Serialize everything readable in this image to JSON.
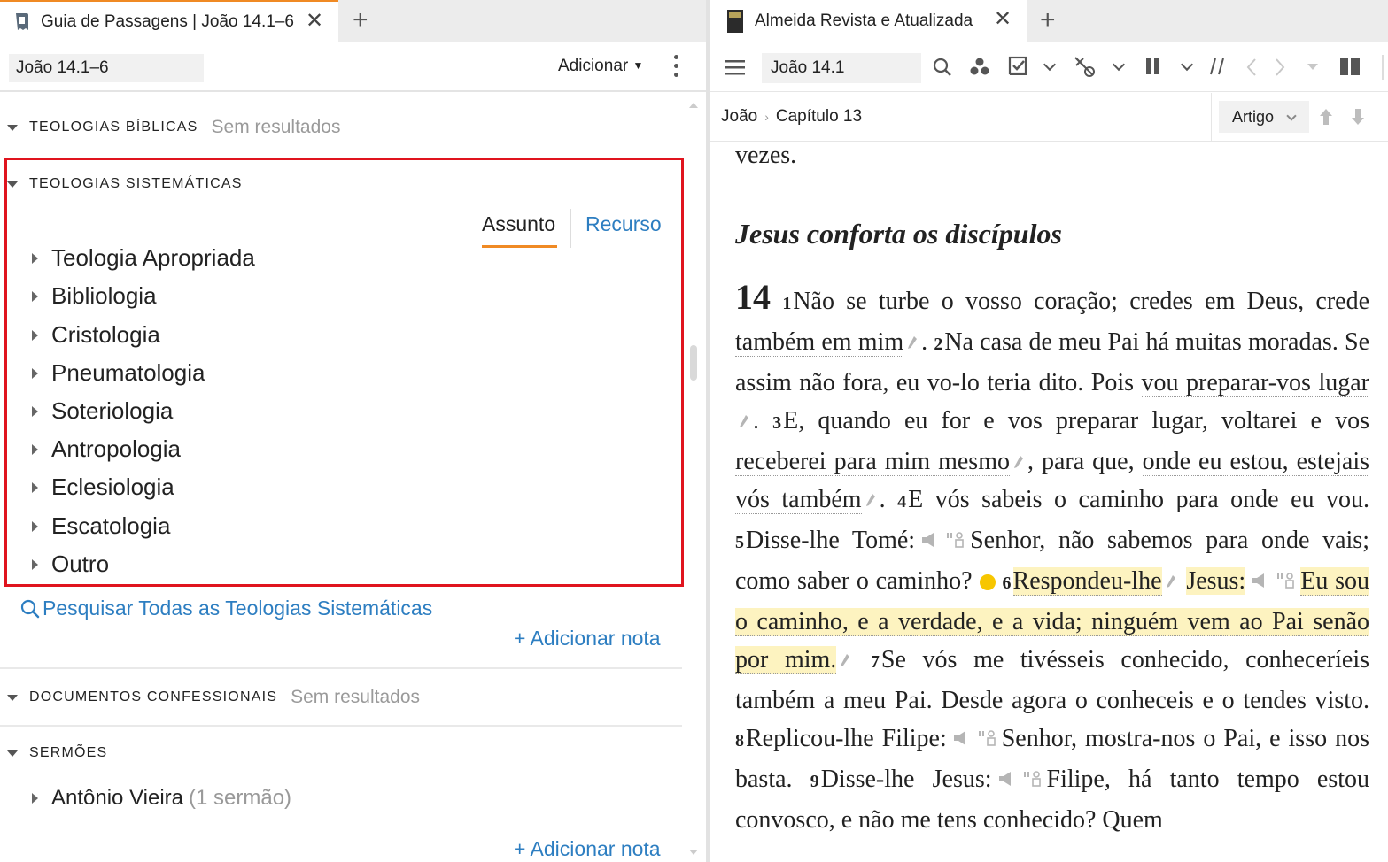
{
  "left_pane": {
    "tab": {
      "title": "Guia de Passagens | João 14.1–6",
      "icon": "guide-book-icon"
    },
    "toolbar": {
      "reference": "João 14.1–6",
      "add_menu": "Adicionar"
    },
    "sections": {
      "biblical": {
        "title": "TEOLOGIAS BÍBLICAS",
        "status": "Sem resultados"
      },
      "systematic": {
        "title": "TEOLOGIAS SISTEMÁTICAS",
        "segments": {
          "subject": "Assunto",
          "resource": "Recurso"
        },
        "items": [
          "Teologia Apropriada",
          "Bibliologia",
          "Cristologia",
          "Pneumatologia",
          "Soteriologia",
          "Antropologia",
          "Eclesiologia",
          "Escatologia",
          "Outro"
        ],
        "search_all": "Pesquisar Todas as Teologias Sistemáticas",
        "add_note": "+ Adicionar nota"
      },
      "confessional": {
        "title": "DOCUMENTOS CONFESSIONAIS",
        "status": "Sem resultados"
      },
      "sermons": {
        "title": "SERMÕES",
        "item": {
          "label": "Antônio Vieira",
          "count": "(1 sermão)"
        },
        "add_note": "+ Adicionar nota"
      }
    }
  },
  "right_pane": {
    "tab": {
      "title": "Almeida Revista e Atualizada",
      "icon": "bible-book-icon"
    },
    "toolbar": {
      "reference": "João 14.1"
    },
    "breadcrumb": {
      "book": "João",
      "chapter": "Capítulo 13"
    },
    "view_mode": "Artigo",
    "text": {
      "prev_tail": "vezes.",
      "heading": "Jesus conforta os discípulos",
      "chapter": "14",
      "v1_num": "1",
      "v1a": "Não se turbe o vosso coração; credes em Deus, crede ",
      "v1b": "também em mim",
      "v2_num": "2",
      "v2a": "Na casa de meu Pai há muitas moradas. Se assim não fora, eu vo-lo teria dito. Pois ",
      "v2b": "vou preparar-vos lugar",
      "v3_num": "3",
      "v3a": "E, quando eu for e vos preparar lugar, ",
      "v3b": "voltarei e vos receberei para mim mesmo",
      "v3c": ", para que, ",
      "v3d": "onde eu estou, estejais vós também",
      "v4_num": "4",
      "v4": "E vós sabeis o caminho para onde eu vou.",
      "v5_num": "5",
      "v5a": "Disse-lhe Tomé:",
      "v5b": "Senhor, não sabemos para onde vais; como saber o caminho?",
      "v6_num": "6",
      "v6a": "Respondeu-lhe",
      "v6b": "Jesus:",
      "v6c": "Eu sou o caminho, e a verdade, e a vida; ninguém vem ao Pai senão por mim.",
      "v7_num": "7",
      "v7": "Se vós me tivésseis conhecido, conheceríeis também a meu Pai. Desde agora o conheceis e o tendes visto.",
      "v8_num": "8",
      "v8a": "Replicou-lhe Filipe:",
      "v8b": "Senhor, mostra-nos o Pai, e isso nos basta.",
      "v9_num": "9",
      "v9a": "Disse-lhe Jesus:",
      "v9b": "Filipe, há tanto tempo estou convosco, e não me tens conhecido? Quem"
    }
  },
  "colors": {
    "link": "#2d7ec1",
    "accent": "#f08a24",
    "highlight_box": "#e0141e",
    "text_highlight": "#fdf3c0"
  }
}
